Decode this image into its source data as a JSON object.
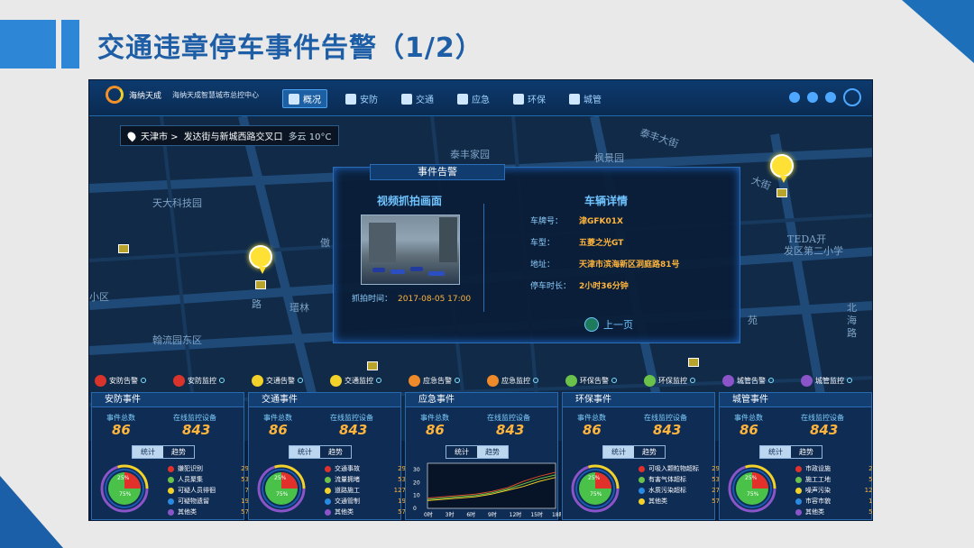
{
  "page_title": "交通违章停车事件告警（1/2）",
  "topbar": {
    "logo_name": "海纳天成",
    "logo_sub": "海纳天成智慧城市总控中心",
    "nav": [
      {
        "label": "概况",
        "icon": "overview-icon",
        "active": true
      },
      {
        "label": "安防",
        "icon": "security-icon",
        "active": false
      },
      {
        "label": "交通",
        "icon": "car-icon",
        "active": false
      },
      {
        "label": "应急",
        "icon": "emergency-icon",
        "active": false
      },
      {
        "label": "环保",
        "icon": "eco-icon",
        "active": false
      },
      {
        "label": "城管",
        "icon": "gear-icon",
        "active": false
      }
    ]
  },
  "location": {
    "city": "天津市 >",
    "place": "发达街与新城西路交叉口",
    "weather": "多云 10°C"
  },
  "map_labels": {
    "a": "泰丰家园",
    "b": "枫景园",
    "c": "天大科技园",
    "d": "TEDA开",
    "e": "发区第二小学",
    "f": "傲",
    "g": "小区",
    "h": "瑨林",
    "i": "翰流园东区",
    "j": "苑",
    "k": "北",
    "l": "海",
    "m": "路",
    "n": "泰丰大街",
    "o": "路",
    "p": "大街"
  },
  "alarm": {
    "tab_title": "事件告警",
    "video_title": "视频抓拍画面",
    "detail_title": "车辆详情",
    "capture_label": "抓拍时间：",
    "capture_time": "2017-08-05 17:00",
    "details": [
      {
        "label": "车牌号：",
        "value": "津GFK01X"
      },
      {
        "label": "车型：",
        "value": "五菱之光GT"
      },
      {
        "label": "地址：",
        "value": "天津市滨海新区洞庭路81号"
      },
      {
        "label": "停车时长：",
        "value": "2小时36分钟"
      }
    ],
    "prev_label": "上一页"
  },
  "legend": [
    {
      "label": "安防告警",
      "color": "#d9342b"
    },
    {
      "label": "安防监控",
      "color": "#d9342b"
    },
    {
      "label": "交通告警",
      "color": "#f2d12a"
    },
    {
      "label": "交通监控",
      "color": "#f2d12a"
    },
    {
      "label": "应急告警",
      "color": "#ef8a2a"
    },
    {
      "label": "应急监控",
      "color": "#ef8a2a"
    },
    {
      "label": "环保告警",
      "color": "#6ac24a"
    },
    {
      "label": "环保监控",
      "color": "#6ac24a"
    },
    {
      "label": "城管告警",
      "color": "#8b54c9"
    },
    {
      "label": "城管监控",
      "color": "#8b54c9"
    }
  ],
  "common": {
    "total_label": "事件总数",
    "online_label": "在线监控设备",
    "total": "86",
    "online": "843",
    "tab_stat": "统计",
    "tab_trend": "趋势",
    "donut_a": "25%",
    "donut_b": "75%"
  },
  "panels": [
    {
      "title": "安防事件",
      "cats": [
        {
          "label": "嫌犯识别",
          "value": "29",
          "color": "#e2302a"
        },
        {
          "label": "人员聚集",
          "value": "53",
          "color": "#6ac24a"
        },
        {
          "label": "可疑人员徘徊",
          "value": "7",
          "color": "#f2d12a"
        },
        {
          "label": "可疑物遗留",
          "value": "19",
          "color": "#2a8ae2"
        },
        {
          "label": "其他类",
          "value": "57",
          "color": "#8b54c9"
        }
      ]
    },
    {
      "title": "交通事件",
      "cats": [
        {
          "label": "交通事故",
          "value": "29",
          "color": "#e2302a"
        },
        {
          "label": "流量拥堵",
          "value": "53",
          "color": "#6ac24a"
        },
        {
          "label": "道路施工",
          "value": "127",
          "color": "#f2d12a"
        },
        {
          "label": "交通管制",
          "value": "19",
          "color": "#2a8ae2"
        },
        {
          "label": "其他类",
          "value": "57",
          "color": "#8b54c9"
        }
      ]
    },
    {
      "title": "应急事件",
      "cats": []
    },
    {
      "title": "环保事件",
      "cats": [
        {
          "label": "可吸入颗粒物超标",
          "value": "29",
          "color": "#e2302a"
        },
        {
          "label": "有害气体超标",
          "value": "53",
          "color": "#6ac24a"
        },
        {
          "label": "水质污染超标",
          "value": "27",
          "color": "#2a8ae2"
        },
        {
          "label": "其他类",
          "value": "57",
          "color": "#f2d12a"
        }
      ]
    },
    {
      "title": "城管事件",
      "cats": [
        {
          "label": "市政设施",
          "value": "29",
          "color": "#e2302a"
        },
        {
          "label": "施工工地",
          "value": "53",
          "color": "#6ac24a"
        },
        {
          "label": "噪声污染",
          "value": "127",
          "color": "#f2d12a"
        },
        {
          "label": "市容市貌",
          "value": "19",
          "color": "#2a8ae2"
        },
        {
          "label": "其他类",
          "value": "57",
          "color": "#8b54c9"
        }
      ]
    }
  ],
  "chart_data": {
    "type": "line",
    "x": [
      "0时",
      "3时",
      "6时",
      "9时",
      "12时",
      "15时",
      "18时"
    ],
    "yticks": [
      "0",
      "10",
      "20",
      "30"
    ],
    "ylim": [
      0,
      35
    ],
    "series": [
      {
        "color": "#d94a2a",
        "values": [
          8,
          9,
          10,
          11,
          13,
          16,
          21,
          25,
          28
        ]
      },
      {
        "color": "#6ac24a",
        "values": [
          7,
          8,
          9,
          10,
          12,
          15,
          19,
          23,
          26
        ]
      },
      {
        "color": "#f2d12a",
        "values": [
          6,
          7,
          8,
          9,
          11,
          14,
          17,
          21,
          24
        ]
      }
    ]
  }
}
